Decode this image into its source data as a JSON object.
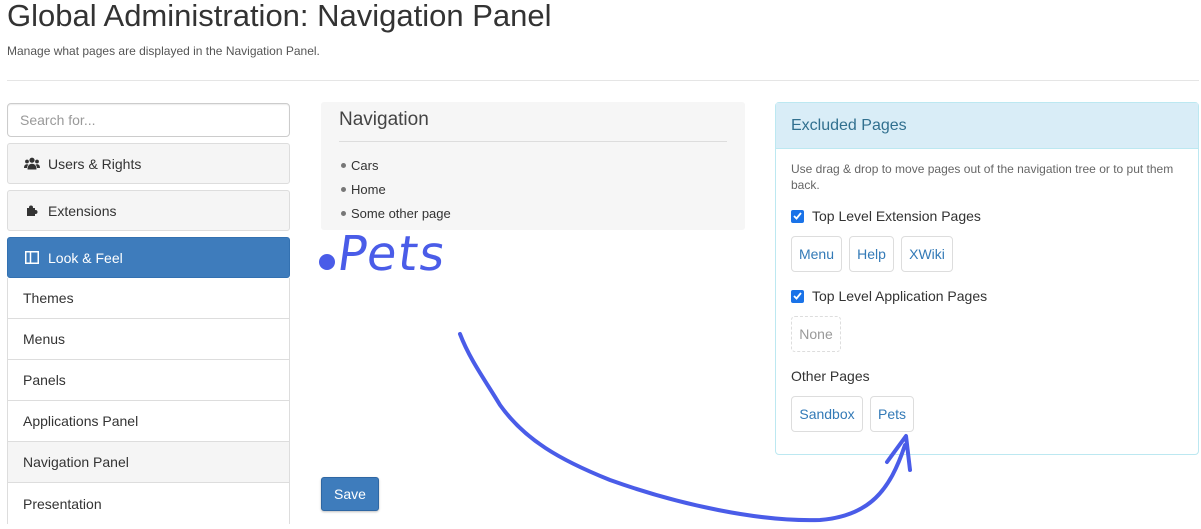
{
  "header": {
    "title": "Global Administration: Navigation Panel",
    "subtitle": "Manage what pages are displayed in the Navigation Panel."
  },
  "sidebar": {
    "search_placeholder": "Search for...",
    "categories": [
      {
        "label": "Users & Rights",
        "icon": "users-icon"
      },
      {
        "label": "Extensions",
        "icon": "puzzle-icon"
      },
      {
        "label": "Look & Feel",
        "icon": "layout-icon",
        "active": true
      }
    ],
    "sub_items": [
      {
        "label": "Themes"
      },
      {
        "label": "Menus"
      },
      {
        "label": "Panels"
      },
      {
        "label": "Applications Panel"
      },
      {
        "label": "Navigation Panel",
        "selected": true
      },
      {
        "label": "Presentation"
      }
    ]
  },
  "navigation": {
    "title": "Navigation",
    "items": [
      "Cars",
      "Home",
      "Some other page"
    ]
  },
  "save_label": "Save",
  "excluded": {
    "title": "Excluded Pages",
    "help": "Use drag & drop to move pages out of the navigation tree or to put them back.",
    "groups": [
      {
        "label": "Top Level Extension Pages",
        "checked": true,
        "pages": [
          "Menu",
          "Help",
          "XWiki"
        ]
      },
      {
        "label": "Top Level Application Pages",
        "checked": true,
        "pages": [],
        "empty_label": "None"
      },
      {
        "label": "Other Pages",
        "pages": [
          "Sandbox",
          "Pets"
        ]
      }
    ]
  },
  "annotation": {
    "text": "Pets",
    "color": "#4a5ce8"
  },
  "colors": {
    "accent": "#3e7cbc",
    "info_bg": "#d9edf7",
    "info_text": "#31708f",
    "link": "#337ab7"
  }
}
